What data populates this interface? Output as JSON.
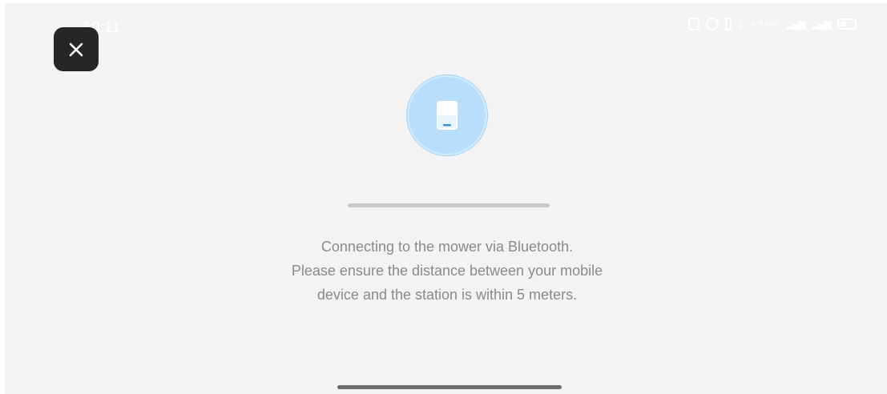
{
  "status_bar": {
    "time": "10:11",
    "icons": [
      "nfc-icon",
      "alarm-icon",
      "vibrate-icon",
      "bluetooth-icon",
      "network-speed-icon",
      "signal-icon",
      "signal-icon",
      "battery-icon"
    ],
    "network_speed": "0.78 KB/S"
  },
  "close_button": {
    "icon": "close-icon",
    "glyph": "✕"
  },
  "device_illustration": {
    "icon": "station-icon",
    "circle_color": "#b9defc",
    "device_color": "#ffffff"
  },
  "progress": {
    "value": 1.0
  },
  "message": {
    "lines": [
      "Connecting to the mower via Bluetooth.",
      "Please ensure the distance between your mobile",
      "device and the station is within 5 meters."
    ]
  },
  "colors": {
    "background": "#f3f3f3",
    "text": "#8a8a8a",
    "close_button_bg": "#262626"
  }
}
